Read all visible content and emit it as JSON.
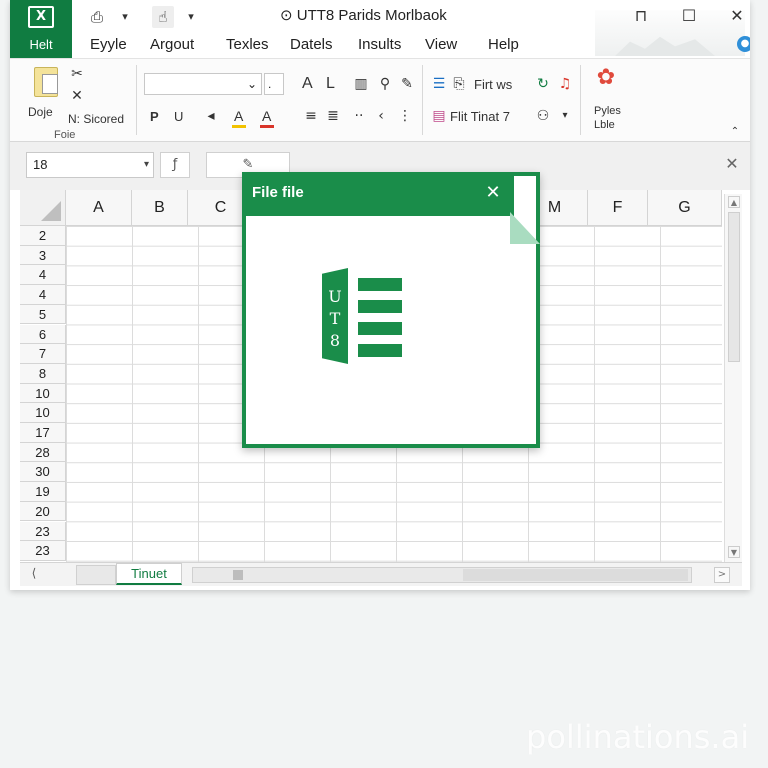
{
  "window": {
    "title": "⊙ UTT8 Parids Morlbaok",
    "minimize_glyph": "⊓",
    "maximize_glyph": "☐",
    "close_glyph": "✕"
  },
  "app": {
    "logo_letter": "X",
    "file_tab_label": "Helt"
  },
  "quick_access": {
    "save_glyph": "⎙",
    "dropdown_glyph": "▾",
    "touch_glyph": "☝",
    "customize_glyph": "▾"
  },
  "ribbon_tabs": [
    "Eyyle",
    "Argout",
    "Texles",
    "Datels",
    "Insults",
    "View",
    "Help"
  ],
  "ribbon": {
    "clipboard": {
      "paste_label": "Doje",
      "cut_glyph": "✂",
      "copy_glyph": "✕",
      "format_painter_label": "N: Sicored",
      "group_label": "Foie"
    },
    "font": {
      "font_name": "",
      "font_size_glyph": "⌄",
      "increase_label": "A",
      "decrease_label": "L",
      "bold_label": "P",
      "italic_label": "U",
      "fill_label": "A",
      "font_color_label": "A",
      "fill_color": "#f2c200",
      "font_color": "#d9352a"
    },
    "alignment": {
      "wrap_label": "Firt ws",
      "merge_label": "Flit Tinat 7"
    },
    "editing": {
      "addins_label_line1": "Pyles",
      "addins_label_line2": "Lble"
    },
    "collapse_glyph": "⌃"
  },
  "formula_bar": {
    "name_box_value": "18",
    "name_box_arrow": "▾",
    "fx_glyph": "ƒ",
    "cancel_glyph": "✎",
    "close_glyph": "✕"
  },
  "grid": {
    "columns": [
      "A",
      "B",
      "C",
      "",
      "",
      "",
      "",
      "M",
      "F",
      "G"
    ],
    "rows": [
      "2",
      "3",
      "4",
      "4",
      "5",
      "6",
      "7",
      "8",
      "10",
      "10",
      "17",
      "28",
      "30",
      "19",
      "20",
      "23",
      "23"
    ]
  },
  "sheets": {
    "nav_glyph": "⟨",
    "active_tab": "Tinuet",
    "scroll_right_glyph": ">"
  },
  "dialog": {
    "title": "File file",
    "close_glyph": "✕",
    "logo_text": "U T 8"
  },
  "watermark": "pollinations.ai",
  "colors": {
    "brand_green": "#107c41",
    "dialog_green": "#1a8d4a"
  }
}
